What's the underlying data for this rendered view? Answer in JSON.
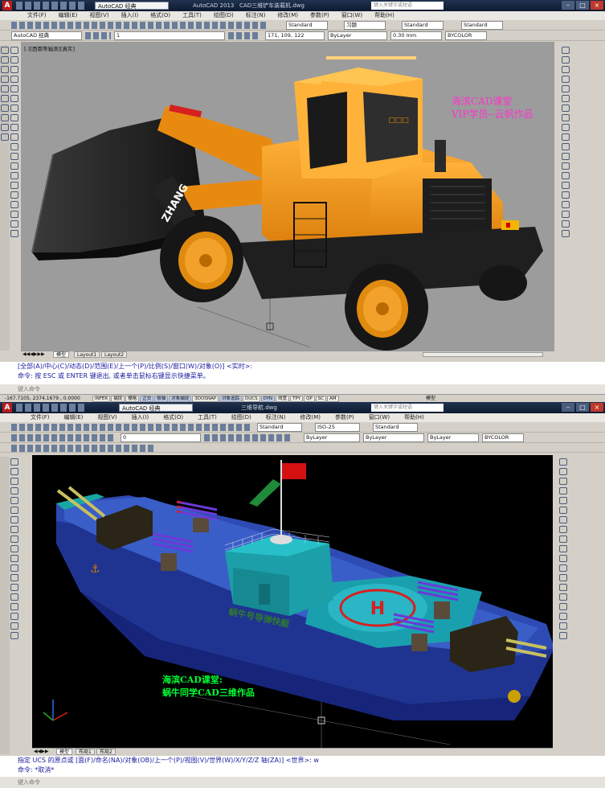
{
  "window1": {
    "app_title": "AutoCAD 2013",
    "file_title": "CAD三维铲车装载机.dwg",
    "workspace": "AutoCAD 经典",
    "search_placeholder": "键入关键字或短语",
    "menu": [
      "文件(F)",
      "编辑(E)",
      "视图(V)",
      "插入(I)",
      "格式(O)",
      "工具(T)",
      "绘图(D)",
      "标注(N)",
      "修改(M)",
      "参数(P)",
      "窗口(W)",
      "帮助(H)"
    ],
    "styles": {
      "text": "Standard",
      "dim": "习题",
      "table": "Standard",
      "mleader": "Standard"
    },
    "layers": {
      "layer_name": "1",
      "color": "171, 109, 122",
      "linetype": "ByLayer",
      "lineweight": "0.30 mm",
      "plotstyle": "BYCOLOR"
    },
    "viewport_label": "[-][西南等轴测][真实]",
    "watermark_line1": "海滨CAD课堂",
    "watermark_line2": "VIP学员--云帆作品",
    "loader_brand": "ZHANG",
    "tabs": [
      "模型",
      "Layout1",
      "Layout2"
    ],
    "command_history": "[全部(A)/中心(C)/动态(D)/范围(E)/上一个(P)/比例(S)/窗口(W)/对象(O)] <实时>:",
    "command_line2": "命令:  按 ESC 或 ENTER 键退出, 或者单击鼠标右键显示快捷菜单。",
    "command_prompt": "键入命令",
    "coords": "-167.7105, 2374.1679 , 0.0000",
    "status_buttons": [
      "INFER",
      "捕捉",
      "栅格",
      "正交",
      "极轴",
      "对象捕捉",
      "3DOSNAP",
      "对象追踪",
      "DUCS",
      "DYN",
      "线宽",
      "TPY",
      "QP",
      "SC",
      "AM"
    ],
    "model_label": "模型"
  },
  "window2": {
    "app_title": "AutoCAD 经典",
    "file_title": "三维导航.dwg",
    "search_placeholder": "键入关键字或短语",
    "menu": [
      "文件(F)",
      "编辑(E)",
      "视图(V)",
      "插入(I)",
      "格式(O)",
      "工具(T)",
      "绘图(D)",
      "标注(N)",
      "修改(M)",
      "参数(P)",
      "窗口(W)",
      "帮助(H)"
    ],
    "styles": {
      "text": "Standard",
      "dim": "ISO-25",
      "table": "Standard"
    },
    "layers": {
      "layer_name": "0",
      "color": "ByLayer",
      "linetype": "ByLayer",
      "lineweight": "ByLayer",
      "plotstyle": "BYCOLOR"
    },
    "watermark_line1": "海滨CAD课堂:",
    "watermark_line2": "蜗牛同学CAD三维作品",
    "ship_text": "蜗牛号导弹快艇",
    "tabs": [
      "模型",
      "布局1",
      "布局2"
    ],
    "command_history": "指定 UCS 的原点或 [面(F)/命名(NA)/对象(OB)/上一个(P)/视图(V)/世界(W)/X/Y/Z/Z 轴(ZA)] <世界>: w",
    "command_line2": "命令: *取消*",
    "command_prompt": "键入命令"
  },
  "colors": {
    "cad_gray": "#9c9c9c",
    "ship_bg": "#000000",
    "loader_orange": "#f29a1c",
    "ship_hull": "#233a9e",
    "ship_deck": "#2aa8b8",
    "watermark_magenta": "#ff33cc",
    "watermark_green": "#00ff33"
  }
}
